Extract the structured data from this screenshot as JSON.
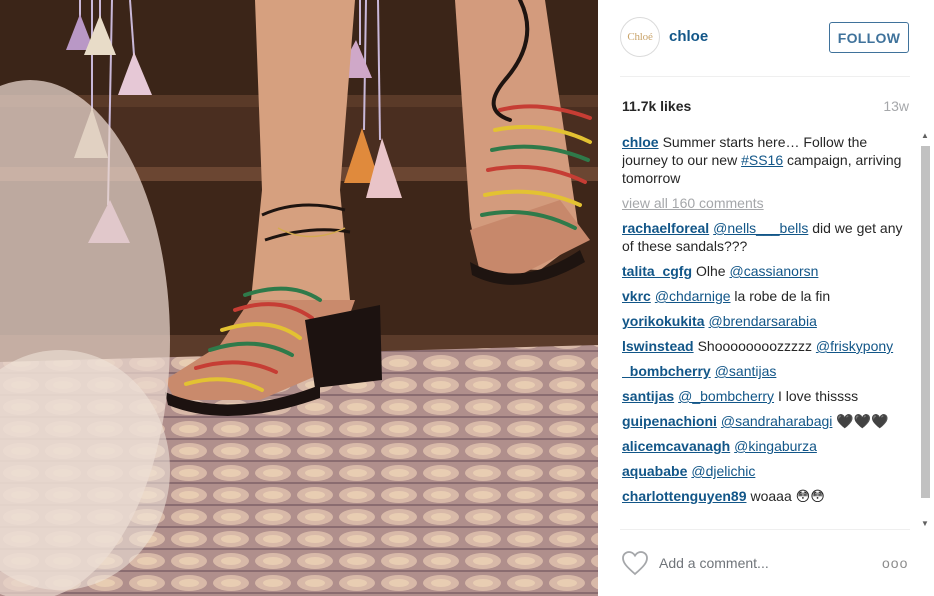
{
  "post": {
    "username": "chloe",
    "avatar_text": "Chloé",
    "follow_label": "FOLLOW",
    "likes": "11.7k likes",
    "age": "13w",
    "caption_user": "chloe",
    "caption_part1": "Summer starts here… Follow the journey to our new",
    "caption_hashtag": "#SS16",
    "caption_part2": "campaign, arriving tomorrow",
    "view_all": "view all 160 comments"
  },
  "comments": [
    {
      "user": "rachaelforeal",
      "mention": "@nells___bells",
      "text": "did we get any of these sandals???"
    },
    {
      "user": "talita_cgfg",
      "text": "Olhe",
      "mention": "@cassianorsn"
    },
    {
      "user": "vkrc",
      "mention": "@chdarnige",
      "text": "la robe de la fin"
    },
    {
      "user": "yorikokukita",
      "mention": "@brendarsarabia",
      "text": ""
    },
    {
      "user": "lswinstead",
      "text": "Shoooooooozzzzz",
      "mention": "@friskypony"
    },
    {
      "user": "_bombcherry",
      "mention": "@santijas",
      "text": ""
    },
    {
      "user": "santijas",
      "mention": "@_bombcherry",
      "text": "I love thissss"
    },
    {
      "user": "guipenachioni",
      "mention": "@sandraharabagi",
      "text": "🖤🖤🖤"
    },
    {
      "user": "alicemcavanagh",
      "mention": "@kingaburza",
      "text": ""
    },
    {
      "user": "aquababe",
      "mention": "@djelichic",
      "text": ""
    },
    {
      "user": "charlottenguyen89",
      "text": "woaaa 😳😳",
      "mention": ""
    }
  ],
  "footer": {
    "add_comment_placeholder": "Add a comment...",
    "more_label": "ooo"
  },
  "icons": {
    "heart": "heart-icon",
    "more": "more-options-icon",
    "scroll_up": "scroll-up-arrow-icon",
    "scroll_down": "scroll-down-arrow-icon"
  },
  "colors": {
    "link_blue": "#125688",
    "follow_blue": "#3f729b",
    "muted_gray": "#a5a7aa"
  }
}
